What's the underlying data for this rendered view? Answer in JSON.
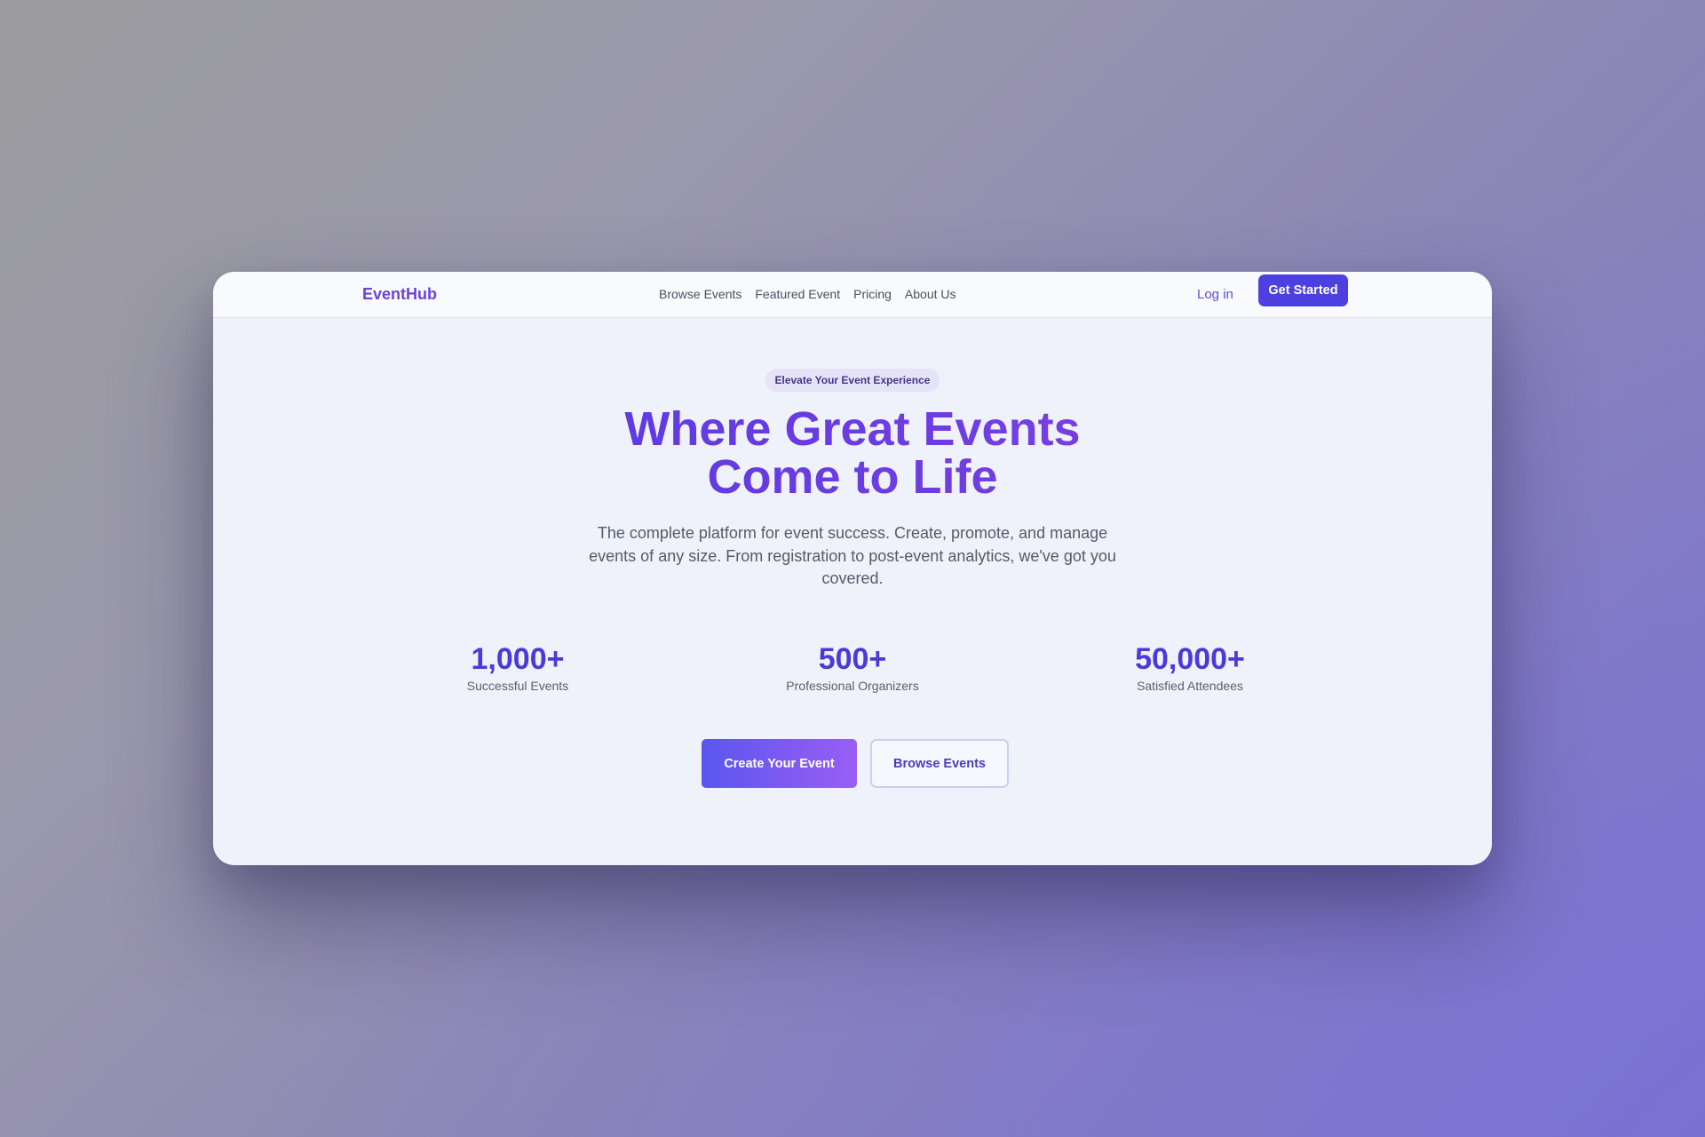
{
  "header": {
    "brand": "EventHub",
    "nav": [
      "Browse Events",
      "Featured Event",
      "Pricing",
      "About Us"
    ],
    "login": "Log in",
    "cta": "Get Started"
  },
  "hero": {
    "badge": "Elevate Your Event Experience",
    "title_line1": "Where Great Events",
    "title_line2": "Come to Life",
    "subtitle": "The complete platform for event success. Create, promote, and manage events of any size. From registration to post-event analytics, we've got you covered."
  },
  "stats": [
    {
      "value": "1,000+",
      "label": "Successful Events"
    },
    {
      "value": "500+",
      "label": "Professional Organizers"
    },
    {
      "value": "50,000+",
      "label": "Satisfied Attendees"
    }
  ],
  "buttons": {
    "primary": "Create Your Event",
    "secondary": "Browse Events"
  },
  "colors": {
    "accent": "#4d3fe0",
    "brand": "#6a42d8",
    "hero_gradient_start": "#5a3ae0",
    "hero_gradient_end": "#7b3fe4"
  }
}
